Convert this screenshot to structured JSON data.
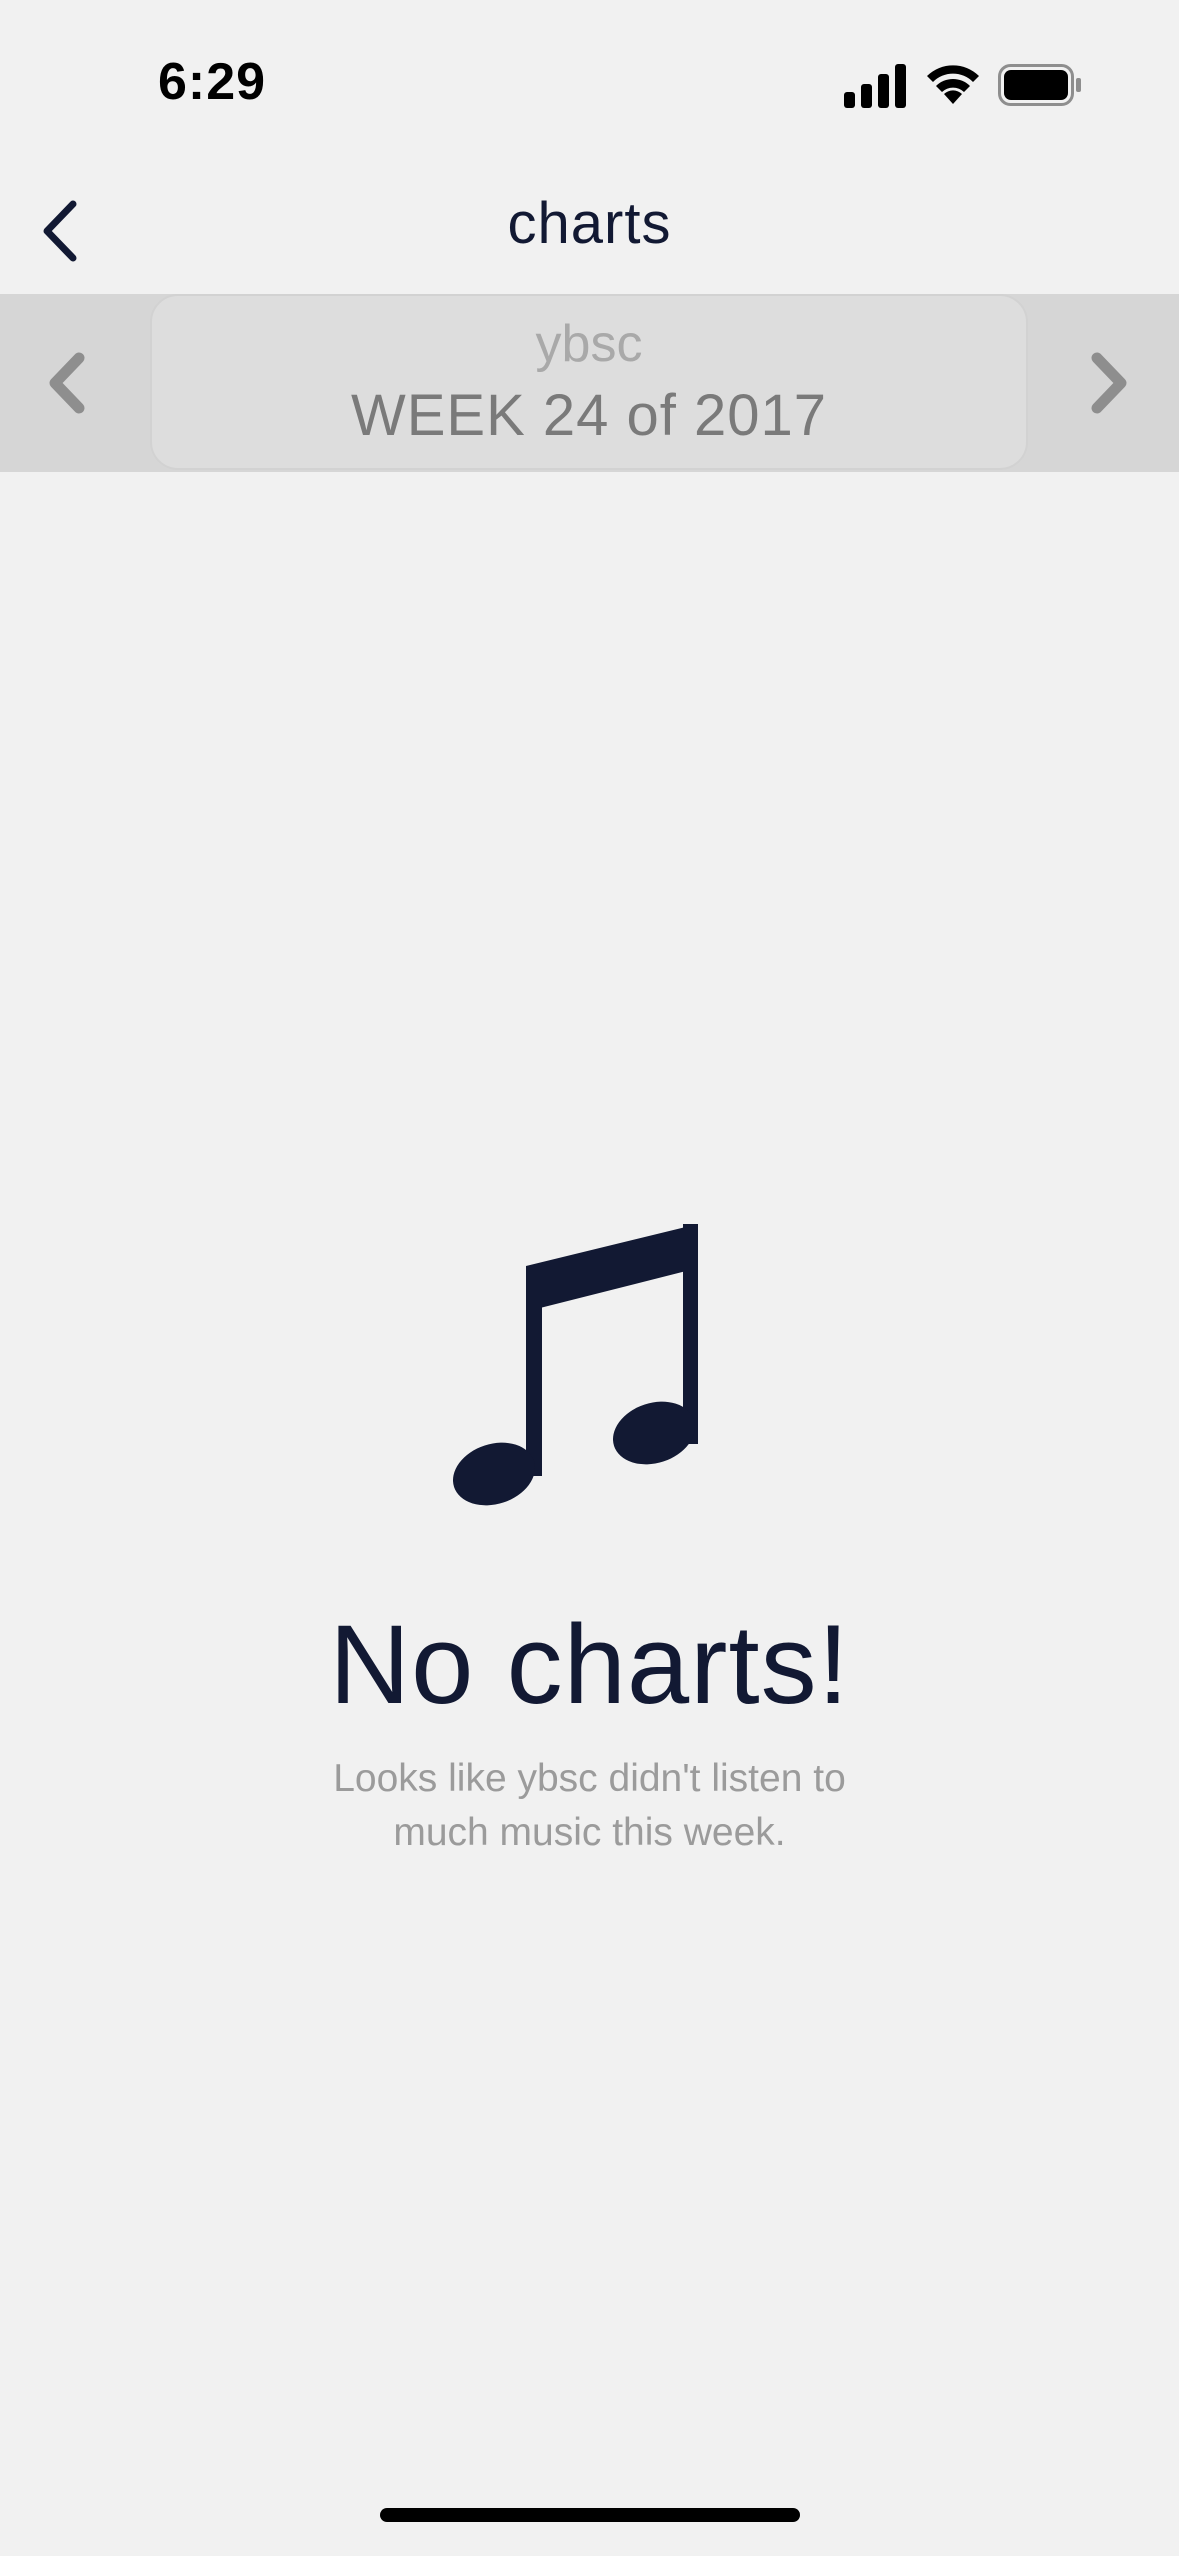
{
  "status_bar": {
    "time": "6:29",
    "signal_icon": "cellular-signal-icon",
    "wifi_icon": "wifi-icon",
    "battery_icon": "battery-icon"
  },
  "nav": {
    "title": "charts",
    "back_icon": "chevron-left-icon"
  },
  "week_selector": {
    "user": "ybsc",
    "label": "WEEK 24 of 2017",
    "prev_icon": "chevron-left-icon",
    "next_icon": "chevron-right-icon"
  },
  "empty_state": {
    "icon": "music-note-icon",
    "title": "No charts!",
    "message": "Looks like ybsc didn't listen to much music this week."
  },
  "colors": {
    "background": "#f1f1f1",
    "primary_text": "#121933",
    "week_bar": "#d6d6d6",
    "muted_text": "#9b9b9b"
  }
}
